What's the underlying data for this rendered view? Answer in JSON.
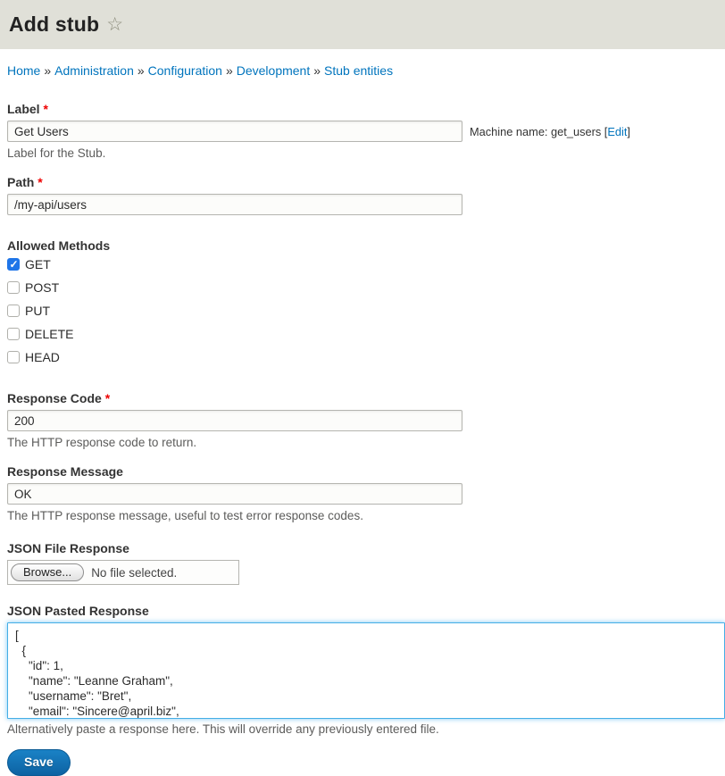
{
  "header": {
    "title": "Add stub",
    "star_glyph": "☆"
  },
  "breadcrumb": {
    "separator": "»",
    "items": [
      "Home",
      "Administration",
      "Configuration",
      "Development",
      "Stub entities"
    ]
  },
  "form": {
    "required_marker": "*",
    "label_field": {
      "label": "Label",
      "value": "Get Users",
      "machine_prefix": "Machine name: get_users [",
      "edit_label": "Edit",
      "machine_suffix": "]",
      "description": "Label for the Stub."
    },
    "path_field": {
      "label": "Path",
      "value": "/my-api/users"
    },
    "allowed_methods": {
      "label": "Allowed Methods",
      "options": [
        {
          "label": "GET",
          "checked": true
        },
        {
          "label": "POST",
          "checked": false
        },
        {
          "label": "PUT",
          "checked": false
        },
        {
          "label": "DELETE",
          "checked": false
        },
        {
          "label": "HEAD",
          "checked": false
        }
      ]
    },
    "response_code": {
      "label": "Response Code",
      "value": "200",
      "description": "The HTTP response code to return."
    },
    "response_message": {
      "label": "Response Message",
      "value": "OK",
      "description": "The HTTP response message, useful to test error response codes."
    },
    "json_file": {
      "label": "JSON File Response",
      "browse_label": "Browse...",
      "no_file_text": "No file selected."
    },
    "json_pasted": {
      "label": "JSON Pasted Response",
      "value": "[\n  {\n    \"id\": 1,\n    \"name\": \"Leanne Graham\",\n    \"username\": \"Bret\",\n    \"email\": \"Sincere@april.biz\",",
      "description": "Alternatively paste a response here. This will override any previously entered file."
    },
    "save_label": "Save"
  },
  "colors": {
    "link": "#0074bd",
    "required": "#ee0000",
    "checkbox_checked": "#1f75e8",
    "focus_border": "#45aee6",
    "header_bg": "#e0e0d8",
    "button_bg": "#0d62a2"
  }
}
